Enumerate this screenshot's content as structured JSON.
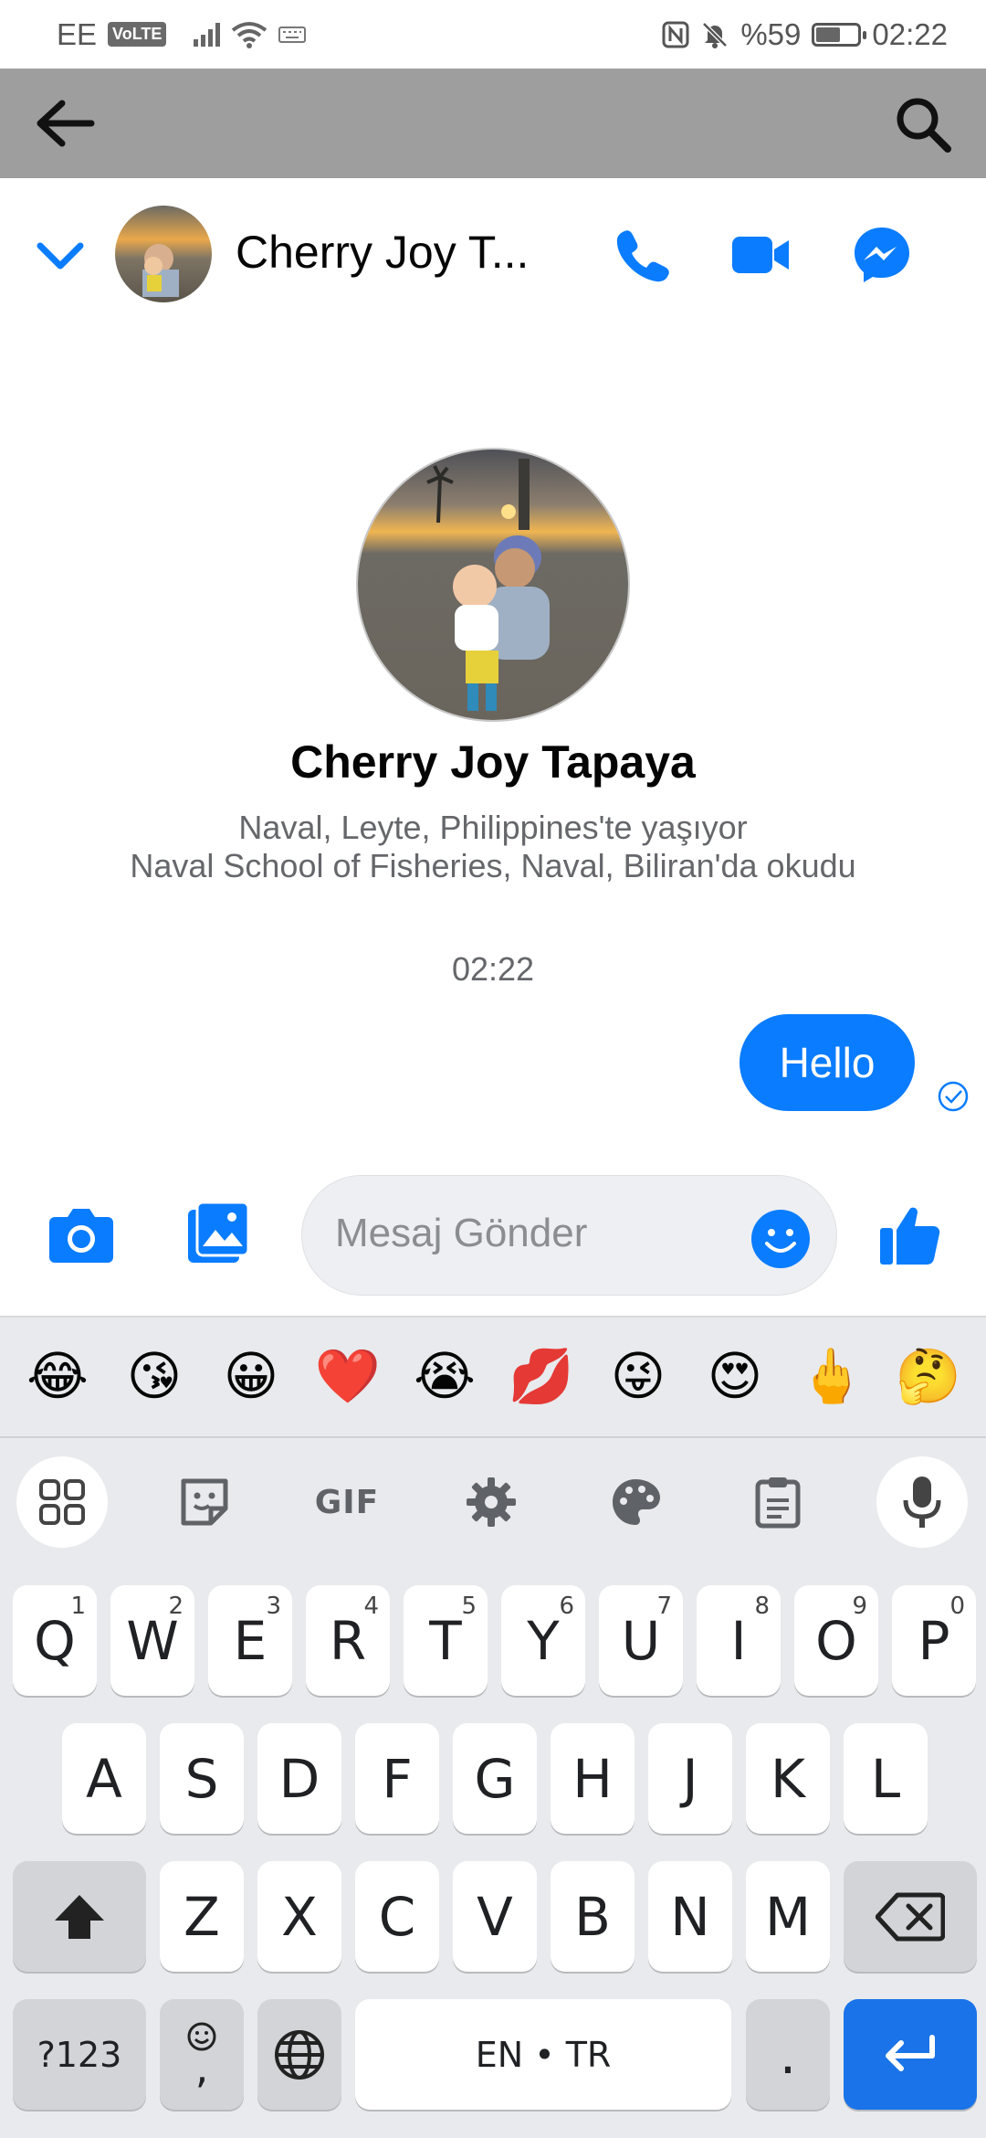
{
  "status_bar": {
    "carrier": "EE",
    "volte": "VoLTE",
    "battery": "%59",
    "battery_level": 0.59,
    "time": "02:22"
  },
  "chat_header": {
    "contact_name_truncated": "Cherry Joy T..."
  },
  "profile": {
    "name": "Cherry Joy Tapaya",
    "lives_in": "Naval, Leyte, Philippines'te yaşıyor",
    "studied_at": "Naval School of Fisheries, Naval, Biliran'da okudu"
  },
  "conversation": {
    "timestamp": "02:22",
    "messages": [
      {
        "text": "Hello",
        "sender": "me",
        "status": "sent"
      }
    ]
  },
  "composer": {
    "placeholder": "Mesaj Gönder"
  },
  "keyboard": {
    "emoji_suggestions": [
      "😂",
      "😘",
      "😀",
      "❤️",
      "😭",
      "💋",
      "😜",
      "😍",
      "🖕",
      "🤔"
    ],
    "toolbar": {
      "gif_label": "GIF"
    },
    "row1": [
      {
        "key": "Q",
        "hint": "1"
      },
      {
        "key": "W",
        "hint": "2"
      },
      {
        "key": "E",
        "hint": "3"
      },
      {
        "key": "R",
        "hint": "4"
      },
      {
        "key": "T",
        "hint": "5"
      },
      {
        "key": "Y",
        "hint": "6"
      },
      {
        "key": "U",
        "hint": "7"
      },
      {
        "key": "I",
        "hint": "8"
      },
      {
        "key": "O",
        "hint": "9"
      },
      {
        "key": "P",
        "hint": "0"
      }
    ],
    "row2": [
      "A",
      "S",
      "D",
      "F",
      "G",
      "H",
      "J",
      "K",
      "L"
    ],
    "row3": [
      "Z",
      "X",
      "C",
      "V",
      "B",
      "N",
      "M"
    ],
    "symbols_label": "?123",
    "comma_label": ",",
    "space_label": "EN • TR",
    "period_label": "."
  },
  "colors": {
    "messenger_blue": "#0a7cff",
    "toolbar_grey": "#9e9e9e",
    "keyboard_bg": "#e8eaed",
    "enter_blue": "#1a73e8"
  },
  "icons": {
    "toolbar": [
      "back-arrow-icon",
      "search-icon"
    ],
    "header": [
      "chevron-down-icon",
      "phone-icon",
      "video-camera-icon",
      "messenger-icon"
    ],
    "composer": [
      "camera-icon",
      "gallery-icon",
      "emoji-icon",
      "thumbs-up-icon"
    ],
    "keyboard": [
      "apps-grid-icon",
      "sticker-icon",
      "settings-icon",
      "palette-icon",
      "clipboard-icon",
      "microphone-icon",
      "shift-icon",
      "backspace-icon",
      "globe-icon",
      "enter-icon"
    ]
  }
}
